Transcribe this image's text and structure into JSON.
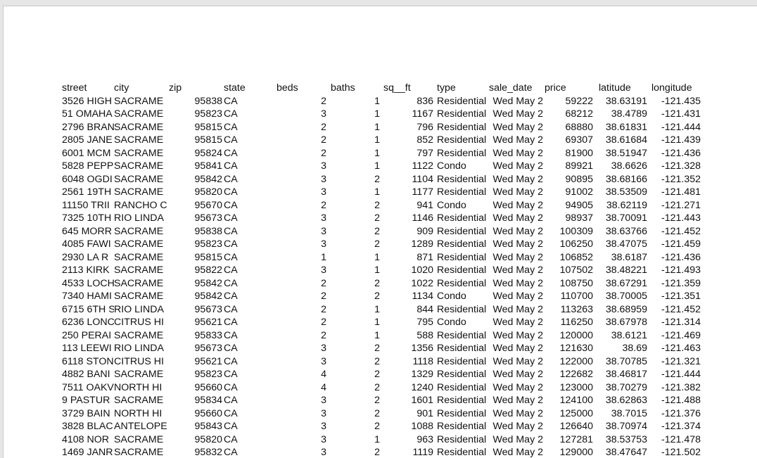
{
  "headers": [
    "street",
    "city",
    "zip",
    "state",
    "beds",
    "baths",
    "sq__ft",
    "type",
    "sale_date",
    "price",
    "latitude",
    "longitude"
  ],
  "rows": [
    [
      "3526 HIGH",
      "SACRAME",
      "95838",
      "CA",
      "2",
      "1",
      "836",
      "Residential",
      "Wed May 2",
      "59222",
      "38.63191",
      "-121.435"
    ],
    [
      "51 OMAHA",
      "SACRAME",
      "95823",
      "CA",
      "3",
      "1",
      "1167",
      "Residential",
      "Wed May 2",
      "68212",
      "38.4789",
      "-121.431"
    ],
    [
      "2796 BRAN",
      "SACRAME",
      "95815",
      "CA",
      "2",
      "1",
      "796",
      "Residential",
      "Wed May 2",
      "68880",
      "38.61831",
      "-121.444"
    ],
    [
      "2805 JANE",
      "SACRAME",
      "95815",
      "CA",
      "2",
      "1",
      "852",
      "Residential",
      "Wed May 2",
      "69307",
      "38.61684",
      "-121.439"
    ],
    [
      "6001 MCM",
      "SACRAME",
      "95824",
      "CA",
      "2",
      "1",
      "797",
      "Residential",
      "Wed May 2",
      "81900",
      "38.51947",
      "-121.436"
    ],
    [
      "5828 PEPP",
      "SACRAME",
      "95841",
      "CA",
      "3",
      "1",
      "1122",
      "Condo",
      "Wed May 2",
      "89921",
      "38.6626",
      "-121.328"
    ],
    [
      "6048 OGDI",
      "SACRAME",
      "95842",
      "CA",
      "3",
      "2",
      "1104",
      "Residential",
      "Wed May 2",
      "90895",
      "38.68166",
      "-121.352"
    ],
    [
      "2561 19TH",
      "SACRAME",
      "95820",
      "CA",
      "3",
      "1",
      "1177",
      "Residential",
      "Wed May 2",
      "91002",
      "38.53509",
      "-121.481"
    ],
    [
      "11150 TRII",
      "RANCHO C",
      "95670",
      "CA",
      "2",
      "2",
      "941",
      "Condo",
      "Wed May 2",
      "94905",
      "38.62119",
      "-121.271"
    ],
    [
      "7325 10TH",
      "RIO LINDA",
      "95673",
      "CA",
      "3",
      "2",
      "1146",
      "Residential",
      "Wed May 2",
      "98937",
      "38.70091",
      "-121.443"
    ],
    [
      "645 MORR",
      "SACRAME",
      "95838",
      "CA",
      "3",
      "2",
      "909",
      "Residential",
      "Wed May 2",
      "100309",
      "38.63766",
      "-121.452"
    ],
    [
      "4085 FAWI",
      "SACRAME",
      "95823",
      "CA",
      "3",
      "2",
      "1289",
      "Residential",
      "Wed May 2",
      "106250",
      "38.47075",
      "-121.459"
    ],
    [
      "2930 LA R",
      "SACRAME",
      "95815",
      "CA",
      "1",
      "1",
      "871",
      "Residential",
      "Wed May 2",
      "106852",
      "38.6187",
      "-121.436"
    ],
    [
      "2113 KIRK",
      "SACRAME",
      "95822",
      "CA",
      "3",
      "1",
      "1020",
      "Residential",
      "Wed May 2",
      "107502",
      "38.48221",
      "-121.493"
    ],
    [
      "4533 LOCH",
      "SACRAME",
      "95842",
      "CA",
      "2",
      "2",
      "1022",
      "Residential",
      "Wed May 2",
      "108750",
      "38.67291",
      "-121.359"
    ],
    [
      "7340 HAMI",
      "SACRAME",
      "95842",
      "CA",
      "2",
      "2",
      "1134",
      "Condo",
      "Wed May 2",
      "110700",
      "38.70005",
      "-121.351"
    ],
    [
      "6715 6TH S",
      "RIO LINDA",
      "95673",
      "CA",
      "2",
      "1",
      "844",
      "Residential",
      "Wed May 2",
      "113263",
      "38.68959",
      "-121.452"
    ],
    [
      "6236 LONC",
      "CITRUS HI",
      "95621",
      "CA",
      "2",
      "1",
      "795",
      "Condo",
      "Wed May 2",
      "116250",
      "38.67978",
      "-121.314"
    ],
    [
      "250 PERAI",
      "SACRAME",
      "95833",
      "CA",
      "2",
      "1",
      "588",
      "Residential",
      "Wed May 2",
      "120000",
      "38.6121",
      "-121.469"
    ],
    [
      "113 LEEWI",
      "RIO LINDA",
      "95673",
      "CA",
      "3",
      "2",
      "1356",
      "Residential",
      "Wed May 2",
      "121630",
      "38.69",
      "-121.463"
    ],
    [
      "6118 STON",
      "CITRUS HI",
      "95621",
      "CA",
      "3",
      "2",
      "1118",
      "Residential",
      "Wed May 2",
      "122000",
      "38.70785",
      "-121.321"
    ],
    [
      "4882 BANI",
      "SACRAME",
      "95823",
      "CA",
      "4",
      "2",
      "1329",
      "Residential",
      "Wed May 2",
      "122682",
      "38.46817",
      "-121.444"
    ],
    [
      "7511 OAKV",
      "NORTH HI",
      "95660",
      "CA",
      "4",
      "2",
      "1240",
      "Residential",
      "Wed May 2",
      "123000",
      "38.70279",
      "-121.382"
    ],
    [
      "9 PASTUR",
      "SACRAME",
      "95834",
      "CA",
      "3",
      "2",
      "1601",
      "Residential",
      "Wed May 2",
      "124100",
      "38.62863",
      "-121.488"
    ],
    [
      "3729 BAIN",
      "NORTH HI",
      "95660",
      "CA",
      "3",
      "2",
      "901",
      "Residential",
      "Wed May 2",
      "125000",
      "38.7015",
      "-121.376"
    ],
    [
      "3828 BLAC",
      "ANTELOPE",
      "95843",
      "CA",
      "3",
      "2",
      "1088",
      "Residential",
      "Wed May 2",
      "126640",
      "38.70974",
      "-121.374"
    ],
    [
      "4108 NOR",
      "SACRAME",
      "95820",
      "CA",
      "3",
      "1",
      "963",
      "Residential",
      "Wed May 2",
      "127281",
      "38.53753",
      "-121.478"
    ],
    [
      "1469 JANR",
      "SACRAME",
      "95832",
      "CA",
      "3",
      "2",
      "1119",
      "Residential",
      "Wed May 2",
      "129000",
      "38.47647",
      "-121.502"
    ]
  ]
}
